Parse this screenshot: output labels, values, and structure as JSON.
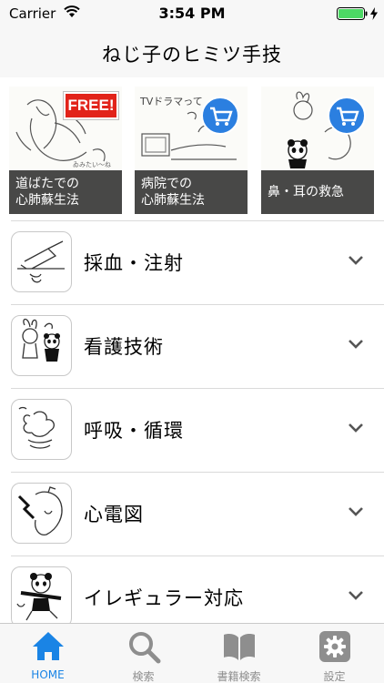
{
  "status_bar": {
    "carrier": "Carrier",
    "time": "3:54 PM"
  },
  "nav": {
    "title": "ねじ子のヒミツ手技"
  },
  "banners": [
    {
      "caption_line1": "道ばたでの",
      "caption_line2": "心肺蘇生法",
      "badge": "FREE!",
      "art_text": "ゐみたい〜ね"
    },
    {
      "caption_line1": "病院での",
      "caption_line2": "心肺蘇生法",
      "badge_icon": "cart-icon",
      "art_text": "TVドラマって"
    },
    {
      "caption_line1": "鼻・耳の救急",
      "caption_line2": "",
      "badge_icon": "cart-icon"
    }
  ],
  "categories": [
    {
      "label": "採血・注射",
      "icon": "syringe-drawing-icon"
    },
    {
      "label": "看護技術",
      "icon": "rabbit-panda-drawing-icon"
    },
    {
      "label": "呼吸・循環",
      "icon": "lungs-drawing-icon"
    },
    {
      "label": "心電図",
      "icon": "heart-drawing-icon"
    },
    {
      "label": "イレギュラー対応",
      "icon": "panda-running-drawing-icon"
    }
  ],
  "tabs": [
    {
      "label": "HOME",
      "icon": "home-icon",
      "active": true
    },
    {
      "label": "検索",
      "icon": "search-icon",
      "active": false
    },
    {
      "label": "書籍検索",
      "icon": "book-icon",
      "active": false
    },
    {
      "label": "設定",
      "icon": "gear-icon",
      "active": false
    }
  ],
  "colors": {
    "accent": "#1a84e5",
    "free_badge": "#e2231a",
    "cart_blue": "#2b7fe0",
    "inactive": "#8e8e8e"
  }
}
